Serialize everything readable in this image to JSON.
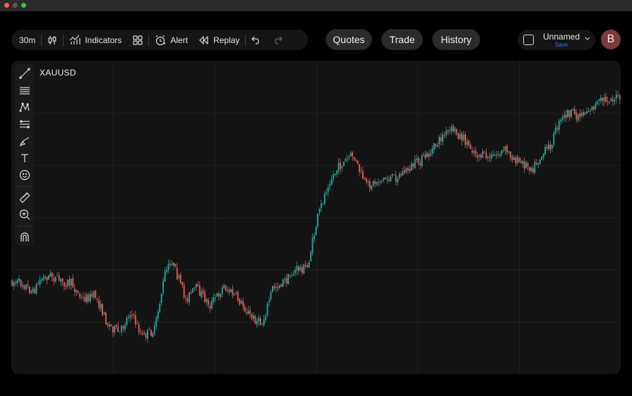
{
  "window": {
    "controls": [
      "close",
      "minimize",
      "zoom"
    ]
  },
  "toolbar": {
    "interval": "30m",
    "chart_type_icon": "candlestick-icon",
    "indicators_label": "Indicators",
    "alert_label": "Alert",
    "replay_label": "Replay"
  },
  "nav": {
    "quotes_label": "Quotes",
    "trade_label": "Trade",
    "history_label": "History"
  },
  "layout": {
    "name": "Unnamed",
    "save_label": "Save"
  },
  "user": {
    "avatar_initial": "B"
  },
  "chart": {
    "symbol": "XAUUSD"
  },
  "drawing_tools": [
    "trend-line-icon",
    "horizontal-lines-icon",
    "pattern-icon",
    "channel-icon",
    "brush-icon",
    "text-icon",
    "emoji-icon",
    "ruler-icon",
    "zoom-in-icon",
    "magnet-icon"
  ],
  "colors": {
    "up": "#26a69a",
    "down": "#ef5350",
    "panel": "#131313",
    "accent": "#3f7bf0",
    "avatar": "#7a3a3f"
  },
  "chart_data": {
    "type": "candlestick",
    "symbol": "XAUUSD",
    "interval": "30m",
    "grid": true,
    "price_path": [
      [
        0,
        0.705
      ],
      [
        6,
        0.71
      ],
      [
        12,
        0.74
      ],
      [
        16,
        0.7
      ],
      [
        22,
        0.685
      ],
      [
        28,
        0.705
      ],
      [
        34,
        0.71
      ],
      [
        40,
        0.76
      ],
      [
        48,
        0.75
      ],
      [
        55,
        0.84
      ],
      [
        62,
        0.87
      ],
      [
        68,
        0.8
      ],
      [
        75,
        0.88
      ],
      [
        82,
        0.86
      ],
      [
        88,
        0.68
      ],
      [
        92,
        0.64
      ],
      [
        100,
        0.76
      ],
      [
        106,
        0.725
      ],
      [
        114,
        0.78
      ],
      [
        122,
        0.72
      ],
      [
        130,
        0.76
      ],
      [
        138,
        0.82
      ],
      [
        144,
        0.84
      ],
      [
        150,
        0.725
      ],
      [
        158,
        0.7
      ],
      [
        164,
        0.665
      ],
      [
        170,
        0.66
      ],
      [
        176,
        0.5
      ],
      [
        182,
        0.39
      ],
      [
        188,
        0.34
      ],
      [
        196,
        0.3
      ],
      [
        204,
        0.4
      ],
      [
        212,
        0.38
      ],
      [
        222,
        0.37
      ],
      [
        232,
        0.33
      ],
      [
        240,
        0.3
      ],
      [
        248,
        0.24
      ],
      [
        254,
        0.22
      ],
      [
        260,
        0.25
      ],
      [
        268,
        0.3
      ],
      [
        276,
        0.31
      ],
      [
        284,
        0.285
      ],
      [
        292,
        0.325
      ],
      [
        300,
        0.34
      ],
      [
        304,
        0.31
      ],
      [
        310,
        0.27
      ],
      [
        314,
        0.21
      ],
      [
        320,
        0.165
      ],
      [
        326,
        0.175
      ],
      [
        334,
        0.15
      ],
      [
        340,
        0.125
      ],
      [
        346,
        0.12
      ],
      [
        350,
        0.12
      ]
    ]
  }
}
